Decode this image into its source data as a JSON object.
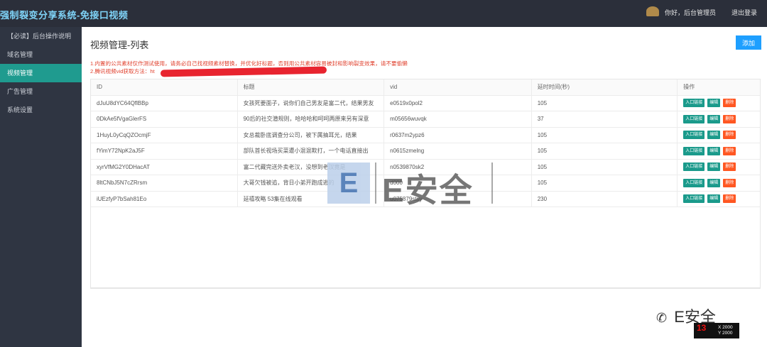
{
  "header": {
    "app_title": "强制裂变分享系统-免接口视频",
    "greeting": "你好，后台管理员",
    "logout": "退出登录"
  },
  "sidebar": {
    "items": [
      {
        "label": "【必读】后台操作说明",
        "active": false
      },
      {
        "label": "域名管理",
        "active": false
      },
      {
        "label": "视频管理",
        "active": true
      },
      {
        "label": "广告管理",
        "active": false
      },
      {
        "label": "系统设置",
        "active": false
      }
    ]
  },
  "main": {
    "title": "视频管理-列表",
    "add_button": "添加",
    "notice_line1": "1.内置的公共素材仅作测试使用，请务必自己找视频素材替换，并优化好标题，否则用公共素材容易被封和影响裂变效果，请不要偷懒",
    "notice_line2": "2.腾讯视频vid获取方法：ht"
  },
  "table": {
    "headers": {
      "id": "ID",
      "title": "标题",
      "vid": "vid",
      "delay": "延时时间(秒)",
      "ops": "操作"
    },
    "rows": [
      {
        "id": "dJuU8dYC64QflBBp",
        "title": "女孩死要面子，说你们自己男友是富二代，结果男友",
        "vid": "e0519x0pol2",
        "delay": "105"
      },
      {
        "id": "0DkAe5fVgaGlerFS",
        "title": "90后的社交潜规则，哈哈哈和呵呵两原来另有深意",
        "vid": "m05656wuvqk",
        "delay": "37"
      },
      {
        "id": "1HuyL0yCqQZOcmjF",
        "title": "女总裁卧底调查分公司，被下属抽耳光，结果",
        "vid": "r0637m2ypz6",
        "delay": "105"
      },
      {
        "id": "fYimY72NpK2aJ5F",
        "title": "部队首长视场买菜遭小混混欺打，一个电话直接出",
        "vid": "n0615zmelng",
        "delay": "105"
      },
      {
        "id": "xyrVfMG2Y0DHacAT",
        "title": "富二代藏完送外卖老汉，没想到老汉竟是",
        "vid": "n0539870sk2",
        "delay": "105"
      },
      {
        "id": "8ltCNbJ5N7cZRrsm",
        "title": "大哥欠钱被追，背日小弟开跑成逃的",
        "vid": "d000",
        "delay": "105"
      },
      {
        "id": "iUEzfyP7bSah81Eo",
        "title": "延禧攻略 53集在线观看",
        "vid": "u075879stsy",
        "delay": "230"
      }
    ],
    "buttons": {
      "entry": "入口链接",
      "edit": "编辑",
      "delete": "删除"
    }
  },
  "watermark": {
    "logo_letter": "E",
    "logo_text": "E安全",
    "corner_text": "E安全",
    "badge_num": "13",
    "badge_line1": "X 2000",
    "badge_line2": "Y 2000"
  }
}
